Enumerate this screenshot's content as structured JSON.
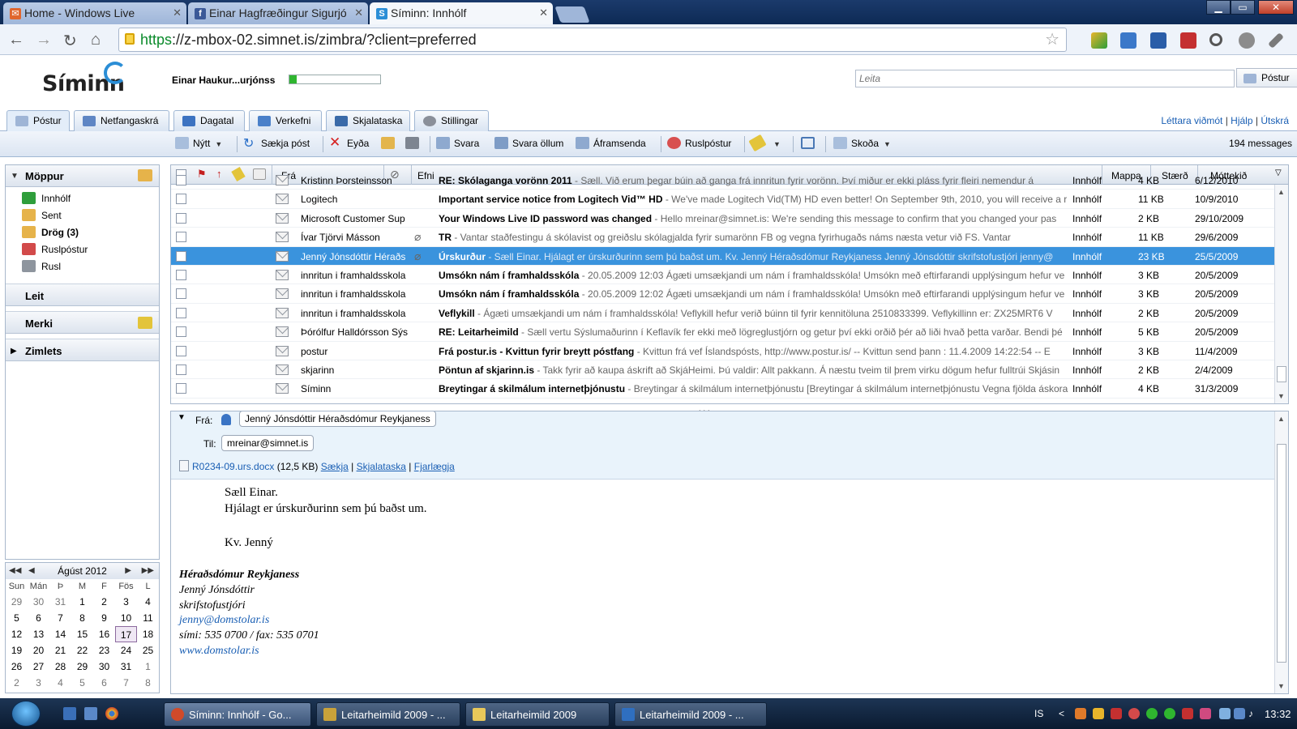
{
  "browser": {
    "tabs": [
      {
        "label": "Home - Windows Live",
        "icon": "mail-icon",
        "color": "#e0662e"
      },
      {
        "label": "Einar Hagfræðingur Sigurjó",
        "icon": "facebook-icon",
        "color": "#3b5998"
      },
      {
        "label": "Síminn: Innhólf",
        "icon": "siminn-icon",
        "color": "#2b8ed6"
      }
    ],
    "url_scheme": "https",
    "url_rest": "://z-mbox-02.simnet.is/zimbra/?client=preferred"
  },
  "app": {
    "logo": "Síminn",
    "user": "Einar Haukur...urjónss",
    "quota_percent": 8,
    "search_placeholder": "Leita",
    "search_scope": "Póstur",
    "tabs": [
      {
        "label": "Póstur",
        "icon": "mail-icon",
        "color": "#9fb5d6"
      },
      {
        "label": "Netfangaskrá",
        "icon": "contacts-icon",
        "color": "#5f86c4"
      },
      {
        "label": "Dagatal",
        "icon": "calendar-icon",
        "color": "#3d73c1"
      },
      {
        "label": "Verkefni",
        "icon": "tasks-icon",
        "color": "#4a80c9"
      },
      {
        "label": "Skjalataska",
        "icon": "briefcase-icon",
        "color": "#3a6aa8"
      },
      {
        "label": "Stillingar",
        "icon": "gear-icon",
        "color": "#8a8f99"
      }
    ],
    "toplinks": {
      "light": "Léttara viðmót",
      "help": "Hjálp",
      "logout": "Útskrá"
    },
    "actions": {
      "new": "Nýtt",
      "fetch": "Sækja póst",
      "delete": "Eyða",
      "reply": "Svara",
      "reply_all": "Svara öllum",
      "forward": "Áframsenda",
      "junk": "Ruslpóstur",
      "view": "Skoða"
    },
    "message_count": "194 messages"
  },
  "sidebar": {
    "folders_header": "Möppur",
    "folders": [
      {
        "label": "Innhólf",
        "color": "#2f9e3b"
      },
      {
        "label": "Sent",
        "color": "#e6b34a"
      },
      {
        "label": "Drög (3)",
        "color": "#e6b34a"
      },
      {
        "label": "Ruslpóstur",
        "color": "#d24a4a"
      },
      {
        "label": "Rusl",
        "color": "#8e959e"
      }
    ],
    "search_header": "Leit",
    "tags_header": "Merki",
    "zimlets_header": "Zimlets"
  },
  "calendar": {
    "month": "Ágúst 2012",
    "day_names": [
      "Sun",
      "Mán",
      "Þ",
      "M",
      "F",
      "Fös",
      "L"
    ],
    "weeks": [
      [
        "29",
        "30",
        "31",
        "1",
        "2",
        "3",
        "4"
      ],
      [
        "5",
        "6",
        "7",
        "8",
        "9",
        "10",
        "11"
      ],
      [
        "12",
        "13",
        "14",
        "15",
        "16",
        "17",
        "18"
      ],
      [
        "19",
        "20",
        "21",
        "22",
        "23",
        "24",
        "25"
      ],
      [
        "26",
        "27",
        "28",
        "29",
        "30",
        "31",
        "1"
      ],
      [
        "2",
        "3",
        "4",
        "5",
        "6",
        "7",
        "8"
      ]
    ],
    "today": "17"
  },
  "list": {
    "headers": {
      "from": "Frá",
      "subject": "Efni",
      "folder": "Mappa",
      "size": "Stærð",
      "received": "Móttekið"
    },
    "rows": [
      {
        "from": "Kristinn Þorsteinsson",
        "subject": "RE: Skólaganga vorönn 2011",
        "fragment": " - Sæll. Við erum þegar búin að ganga frá innritun fyrir vorönn. Því miður er ekki pláss fyrir fleiri nemendur á",
        "folder": "Innhólf",
        "size": "4 KB",
        "date": "6/12/2010",
        "attach": false,
        "selected": false
      },
      {
        "from": "Logitech",
        "subject": "Important service notice from Logitech Vid™ HD",
        "fragment": " - We've made Logitech Vid(TM) HD even better! On September 9th, 2010, you will receive a r",
        "folder": "Innhólf",
        "size": "11 KB",
        "date": "10/9/2010",
        "attach": false,
        "selected": false
      },
      {
        "from": "Microsoft Customer Sup",
        "subject": "Your Windows Live ID password was changed",
        "fragment": " - Hello mreinar@simnet.is: We're sending this message to confirm that you changed your pas",
        "folder": "Innhólf",
        "size": "2 KB",
        "date": "29/10/2009",
        "attach": false,
        "selected": false
      },
      {
        "from": "Ívar Tjörvi Másson",
        "subject": "TR",
        "fragment": " - Vantar staðfestingu á skólavist og greiðslu skólagjalda fyrir sumarönn FB og vegna fyrirhugaðs náms næsta vetur við FS. Vantar",
        "folder": "Innhólf",
        "size": "11 KB",
        "date": "29/6/2009",
        "attach": true,
        "selected": false
      },
      {
        "from": "Jenný Jónsdóttir Héraðs",
        "subject": "Úrskurður",
        "fragment": " - Sæll Einar. Hjálagt er úrskurðurinn sem þú baðst um. Kv. Jenný Héraðsdómur Reykjaness Jenný Jónsdóttir skrifstofustjóri jenny@",
        "folder": "Innhólf",
        "size": "23 KB",
        "date": "25/5/2009",
        "attach": true,
        "selected": true
      },
      {
        "from": "innritun i framhaldsskola",
        "subject": "Umsókn nám í framhaldsskóla",
        "fragment": " - 20.05.2009 12:03 Ágæti umsækjandi um nám í framhaldsskóla! Umsókn með eftirfarandi upplýsingum hefur ve",
        "folder": "Innhólf",
        "size": "3 KB",
        "date": "20/5/2009",
        "attach": false,
        "selected": false
      },
      {
        "from": "innritun i framhaldsskola",
        "subject": "Umsókn nám í framhaldsskóla",
        "fragment": " - 20.05.2009 12:02 Ágæti umsækjandi um nám í framhaldsskóla! Umsókn með eftirfarandi upplýsingum hefur ve",
        "folder": "Innhólf",
        "size": "3 KB",
        "date": "20/5/2009",
        "attach": false,
        "selected": false
      },
      {
        "from": "innritun i framhaldsskola",
        "subject": "Veflykill",
        "fragment": " - Ágæti umsækjandi um nám í framhaldsskóla! Veflykill hefur verið búinn til fyrir kennitöluna 2510833399. Veflykillinn er: ZX25MRT6 V",
        "folder": "Innhólf",
        "size": "2 KB",
        "date": "20/5/2009",
        "attach": false,
        "selected": false
      },
      {
        "from": "Þórólfur Halldórsson Sýs",
        "subject": "RE: Leitarheimild",
        "fragment": " - Sæll vertu Sýslumaðurinn í Keflavík fer ekki með lögreglustjórn og getur því ekki orðið þér að liði hvað þetta varðar. Bendi þé",
        "folder": "Innhólf",
        "size": "5 KB",
        "date": "20/5/2009",
        "attach": false,
        "selected": false
      },
      {
        "from": "postur",
        "subject": "Frá postur.is - Kvittun fyrir breytt póstfang",
        "fragment": " - Kvittun frá vef Íslandspósts, http://www.postur.is/ -- Kvittun send þann : 11.4.2009 14:22:54 -- E",
        "folder": "Innhólf",
        "size": "3 KB",
        "date": "11/4/2009",
        "attach": false,
        "selected": false
      },
      {
        "from": "skjarinn",
        "subject": "Pöntun af skjarinn.is",
        "fragment": " - Takk fyrir að kaupa áskrift að SkjáHeimi. Þú valdir: Allt pakkann. Á næstu tveim til þrem virku dögum hefur fulltrúi Skjásin",
        "folder": "Innhólf",
        "size": "2 KB",
        "date": "2/4/2009",
        "attach": false,
        "selected": false
      },
      {
        "from": "Síminn",
        "subject": "Breytingar á skilmálum internetþjónustu",
        "fragment": " - Breytingar á skilmálum internetþjónustu [Breytingar á skilmálum internetþjónustu Vegna fjölda áskora",
        "folder": "Innhólf",
        "size": "4 KB",
        "date": "31/3/2009",
        "attach": false,
        "selected": false
      }
    ]
  },
  "reading": {
    "from_label": "Frá:",
    "from": "Jenný Jónsdóttir Héraðsdómur Reykjaness",
    "to_label": "Til:",
    "to": "mreinar@simnet.is",
    "attachment_name": "R0234-09.urs.docx",
    "attachment_size": "(12,5 KB)",
    "attachment_actions": {
      "download": "Sækja",
      "briefcase": "Skjalataska",
      "remove": "Fjarlægja"
    },
    "body": {
      "greeting": "Sæll Einar.",
      "line1": "Hjálagt er úrskurðurinn sem þú baðst um.",
      "closing": "Kv. Jenný"
    },
    "signature": {
      "org": "Héraðsdómur Reykjaness",
      "name": "Jenný Jónsdóttir",
      "title": "skrifstofustjóri",
      "email": "jenny@domstolar.is",
      "phone": "sími: 535 0700 / fax: 535 0701",
      "web": "www.domstolar.is"
    }
  },
  "taskbar": {
    "tasks": [
      {
        "label": "Síminn: Innhólf - Go...",
        "color": "#d04a2a",
        "active": true
      },
      {
        "label": "Leitarheimild 2009 - ...",
        "color": "#c9a23a",
        "active": false
      },
      {
        "label": "Leitarheimild 2009",
        "color": "#e8c85a",
        "active": false
      },
      {
        "label": "Leitarheimild 2009 - ...",
        "color": "#2f6fc0",
        "active": false
      }
    ],
    "language": "IS",
    "clock": "13:32"
  }
}
